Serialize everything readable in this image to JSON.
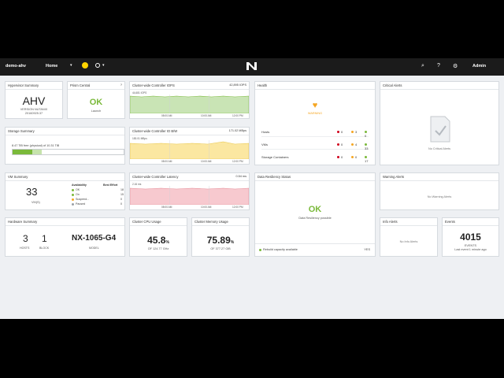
{
  "navbar": {
    "cluster_name": "demo-ahv",
    "home_label": "Home",
    "user": "Admin"
  },
  "hypervisor": {
    "title": "Hypervisor Summary",
    "value": "AHV",
    "version_label": "VERSION NUTANIX",
    "version": "20160925.37"
  },
  "prism": {
    "title": "Prism Central",
    "status": "OK",
    "action": "Launch"
  },
  "iops": {
    "title": "Cluster-wide Controller IOPS",
    "value": "42,895 IOPS",
    "max": "44,681 IOPS",
    "ticks": [
      "08:00 AM",
      "10:00 AM",
      "12:00 PM"
    ]
  },
  "health": {
    "title": "Health",
    "status": "WARNING",
    "rows": [
      {
        "label": "Hosts",
        "red": "0",
        "orange": "3",
        "green": "0"
      },
      {
        "label": "VMs",
        "red": "0",
        "orange": "4",
        "green": "33"
      },
      {
        "label": "Storage Containers",
        "red": "0",
        "orange": "0",
        "green": "17"
      }
    ]
  },
  "critical_alerts": {
    "title": "Critical Alerts",
    "empty": "No Critical Alerts"
  },
  "storage": {
    "title": "Storage Summary",
    "text": "8.47 TiB free (physical) of 10.31 TiB",
    "used_fraction": 0.18
  },
  "io_bw": {
    "title": "Cluster-wide Controller IO B/W",
    "value": "171.02 MBps",
    "max": "183.01 MBps",
    "ticks": [
      "08:00 AM",
      "10:00 AM",
      "12:00 PM"
    ]
  },
  "vm": {
    "title": "VM Summary",
    "count": "33",
    "count_label": "VM(S)",
    "availability_header": "Availability",
    "best_effort_header": "Best Effort",
    "rows": [
      {
        "label": "OK",
        "value": "18"
      },
      {
        "label": "On",
        "value": "15"
      },
      {
        "label": "Suspend...",
        "value": "0"
      },
      {
        "label": "Paused",
        "value": "0"
      }
    ]
  },
  "latency": {
    "title": "Cluster-wide Controller Latency",
    "value": "0.54 ms",
    "max": "2.16 ms",
    "ticks": [
      "08:00 AM",
      "10:00 AM",
      "12:00 PM"
    ]
  },
  "resiliency": {
    "title": "Data Resiliency Status",
    "status": "OK",
    "text": "Data Resiliency possible",
    "rebuild_label": "Rebuild capacity available",
    "rebuild_value": "YES"
  },
  "warning_alerts": {
    "title": "Warning Alerts",
    "empty": "No Warning Alerts"
  },
  "hardware": {
    "title": "Hardware Summary",
    "hosts": "3",
    "hosts_label": "HOSTS",
    "blocks": "1",
    "blocks_label": "BLOCK",
    "model": "NX-1065-G4",
    "model_label": "MODEL"
  },
  "cpu": {
    "title": "Cluster CPU Usage",
    "value": "45.8",
    "unit": "%",
    "sub": "OF 124.77 GHz",
    "fraction": 0.458
  },
  "memory": {
    "title": "Cluster Memory Usage",
    "value": "75.89",
    "unit": "%",
    "sub": "OF 377.27 GiB",
    "fraction": 0.7589
  },
  "info_alerts": {
    "title": "Info Alerts",
    "empty": "No Info Alerts"
  },
  "events": {
    "title": "Events",
    "count": "4015",
    "label": "EVENTS",
    "sub": "Last event 1 minute ago"
  },
  "colors": {
    "iops_fill": "#c9e4b5",
    "bw_fill": "#fbe7a1",
    "latency_fill": "#f7c9cf",
    "ok": "#7ab93a",
    "warning": "#f5a623",
    "critical": "#d0021b"
  }
}
